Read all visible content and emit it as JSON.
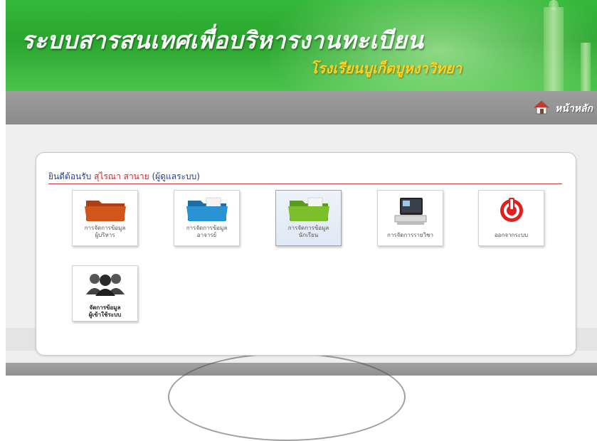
{
  "header": {
    "system_title": "ระบบสารสนเทศเพื่อบริหารงานทะเบียน",
    "school_name": "โรงเรียนบูเก็ตบูหงาวิทยา"
  },
  "nav": {
    "home_label": "หน้าหลัก",
    "home_icon": "home-icon"
  },
  "welcome": {
    "greeting": "ยินดีต้อนรับ",
    "user_name": "สุไรณา สานาย",
    "role": "(ผู้ดูแลระบบ)"
  },
  "menu": [
    {
      "line1": "การจัดการข้อมูล",
      "line2": "ผู้บริหาร",
      "icon": "orange-folder-icon",
      "color": "#d2561c"
    },
    {
      "line1": "การจัดการข้อมูล",
      "line2": "อาจารย์",
      "icon": "blue-folder-icon",
      "color": "#2a93d4"
    },
    {
      "line1": "การจัดการข้อมูล",
      "line2": "นักเรียน",
      "icon": "green-folder-icon",
      "color": "#7cbf2a",
      "selected": true
    },
    {
      "line1": "การจัดการรายวิชา",
      "icon": "computer-monitor-icon"
    },
    {
      "line1": "ออกจากระบบ",
      "icon": "power-icon",
      "color": "#e0201e"
    },
    {
      "line1": "จัดการข้อมูล",
      "line2": "ผู้เข้าใช้ระบบ",
      "icon": "users-group-icon"
    }
  ],
  "colors": {
    "banner_green": "#2aa52e",
    "title_yellow": "#ffd21f",
    "nav_grey": "#8b8b8b",
    "welcome_blue": "#1f3f9a",
    "username_red": "#d81e1e"
  }
}
